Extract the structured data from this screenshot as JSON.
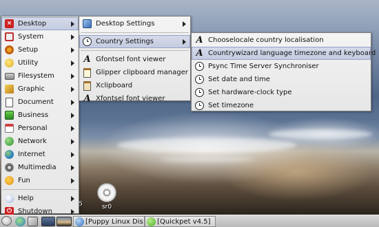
{
  "desktop": {
    "icons": [
      {
        "label": "sr0",
        "icon": "cd-drive-icon"
      },
      {
        "label": "5",
        "icon": "cd-drive-icon"
      }
    ]
  },
  "main_menu": {
    "items": [
      {
        "label": "Desktop",
        "icon": "desktop-icon",
        "color": "#cc2222",
        "has_submenu": true,
        "active": true
      },
      {
        "label": "System",
        "icon": "system-icon",
        "color": "#c03030",
        "has_submenu": true
      },
      {
        "label": "Setup",
        "icon": "setup-icon",
        "color": "#c06010",
        "has_submenu": true
      },
      {
        "label": "Utility",
        "icon": "utility-icon",
        "color": "#d8b020",
        "has_submenu": true
      },
      {
        "label": "Filesystem",
        "icon": "filesystem-icon",
        "color": "#888888",
        "has_submenu": true
      },
      {
        "label": "Graphic",
        "icon": "graphic-icon",
        "color": "#e0b030",
        "has_submenu": true
      },
      {
        "label": "Document",
        "icon": "document-icon",
        "color": "#6a6a6a",
        "has_submenu": true
      },
      {
        "label": "Business",
        "icon": "business-icon",
        "color": "#30a030",
        "has_submenu": true
      },
      {
        "label": "Personal",
        "icon": "personal-icon",
        "color": "#d04040",
        "has_submenu": true
      },
      {
        "label": "Network",
        "icon": "network-icon",
        "color": "#3a9a3a",
        "has_submenu": true
      },
      {
        "label": "Internet",
        "icon": "internet-icon",
        "color": "#2f7fc0",
        "has_submenu": true
      },
      {
        "label": "Multimedia",
        "icon": "multimedia-icon",
        "color": "#505050",
        "has_submenu": true
      },
      {
        "label": "Fun",
        "icon": "fun-icon",
        "color": "#e09020",
        "has_submenu": true
      }
    ],
    "footer_items": [
      {
        "label": "Help",
        "icon": "help-icon",
        "color": "#4070c0",
        "has_submenu": true
      },
      {
        "label": "Shutdown",
        "icon": "shutdown-icon",
        "color": "#cc2020",
        "has_submenu": true
      }
    ]
  },
  "desktop_menu": {
    "items": [
      {
        "label": "Desktop Settings",
        "icon": "settings-icon",
        "has_submenu": true
      },
      {
        "label": "Country Settings",
        "icon": "clock-icon",
        "has_submenu": true,
        "active": true
      },
      {
        "label": "Gfontsel font viewer",
        "icon": "font-icon",
        "has_submenu": false
      },
      {
        "label": "Glipper clipboard manager",
        "icon": "clipboard-icon",
        "has_submenu": false
      },
      {
        "label": "Xclipboard",
        "icon": "clipboard-icon",
        "has_submenu": false
      },
      {
        "label": "Xfontsel font viewer",
        "icon": "font-icon",
        "has_submenu": false
      }
    ]
  },
  "country_menu": {
    "items": [
      {
        "label": "Chooselocale country localisation",
        "icon": "font-icon"
      },
      {
        "label": "Countrywizard language timezone and keyboard",
        "icon": "font-icon",
        "active": true
      },
      {
        "label": "Psync Time Server Synchroniser",
        "icon": "clock-icon"
      },
      {
        "label": "Set date and time",
        "icon": "clock-icon"
      },
      {
        "label": "Set hardware-clock type",
        "icon": "clock-icon"
      },
      {
        "label": "Set timezone",
        "icon": "clock-icon"
      }
    ]
  },
  "taskbar": {
    "tasks": [
      {
        "label": "[Puppy Linux Dis...",
        "icon": "browser-icon",
        "color": "#2f6fc0"
      },
      {
        "label": "[Quickpet v4.5]",
        "icon": "quickpet-icon",
        "color": "#4caf2a"
      }
    ]
  }
}
